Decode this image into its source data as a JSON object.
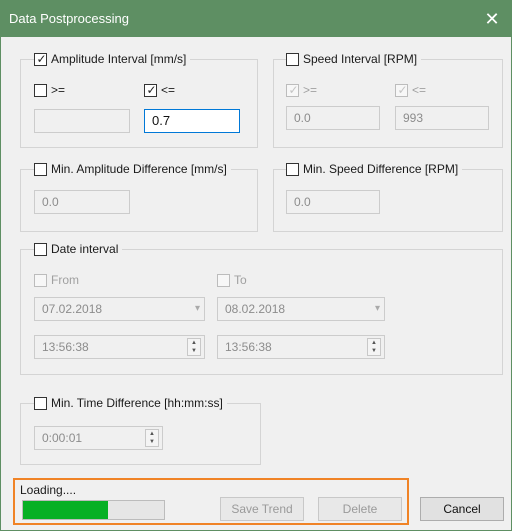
{
  "window": {
    "title": "Data Postprocessing",
    "close_glyph": "✕"
  },
  "amplitude_interval": {
    "label": "Amplitude Interval [mm/s]",
    "checked": true,
    "ge": {
      "label": ">=",
      "checked": false,
      "value": ""
    },
    "le": {
      "label": "<=",
      "checked": true,
      "value": "0.7"
    }
  },
  "speed_interval": {
    "label": "Speed Interval [RPM]",
    "checked": false,
    "ge": {
      "label": ">=",
      "checked": true,
      "value": "0.0"
    },
    "le": {
      "label": "<=",
      "checked": true,
      "value": "993"
    }
  },
  "min_amplitude_difference": {
    "label": "Min. Amplitude Difference [mm/s]",
    "checked": false,
    "value": "0.0"
  },
  "min_speed_difference": {
    "label": "Min. Speed Difference [RPM]",
    "checked": false,
    "value": "0.0"
  },
  "date_interval": {
    "label": "Date interval",
    "checked": false,
    "from": {
      "label": "From",
      "date": "07.02.2018",
      "time": "13:56:38"
    },
    "to": {
      "label": "To",
      "date": "08.02.2018",
      "time": "13:56:38"
    }
  },
  "min_time_difference": {
    "label": "Min. Time Difference [hh:mm:ss]",
    "checked": false,
    "value": "0:00:01"
  },
  "status": {
    "loading_text": "Loading....",
    "progress_fraction": 0.6
  },
  "buttons": {
    "save_trend": "Save Trend",
    "delete": "Delete",
    "cancel": "Cancel"
  },
  "glyphs": {
    "check": "✓",
    "spin_up": "▲",
    "spin_down": "▼",
    "dropdown": "▾"
  },
  "colors": {
    "titlebar": "#5e8f63",
    "progress_fill": "#06b025",
    "highlight_border": "#f08326",
    "focus_border": "#0078d7"
  }
}
